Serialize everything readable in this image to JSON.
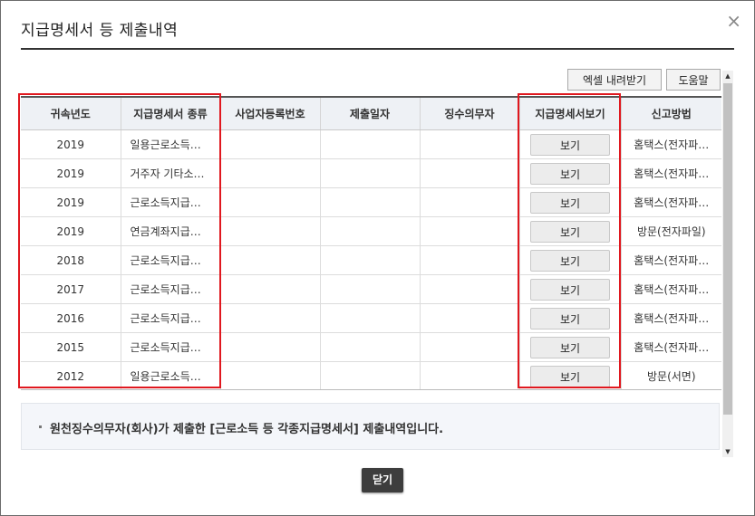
{
  "dialog": {
    "title": "지급명세서 등 제출내역",
    "close_icon": "×"
  },
  "toolbar": {
    "excel_label": "엑셀 내려받기",
    "help_label": "도움말"
  },
  "table": {
    "headers": [
      "귀속년도",
      "지급명세서 종류",
      "사업자등록번호",
      "제출일자",
      "징수의무자",
      "지급명세서보기",
      "신고방법"
    ],
    "rows": [
      {
        "year": "2019",
        "type": "일용근로소득…",
        "biz_no": "",
        "date": "",
        "payer": "",
        "view": "보기",
        "method": "홈택스(전자파…"
      },
      {
        "year": "2019",
        "type": "거주자 기타소…",
        "biz_no": "",
        "date": "",
        "payer": "",
        "view": "보기",
        "method": "홈택스(전자파…"
      },
      {
        "year": "2019",
        "type": "근로소득지급…",
        "biz_no": "",
        "date": "",
        "payer": "",
        "view": "보기",
        "method": "홈택스(전자파…"
      },
      {
        "year": "2019",
        "type": "연금계좌지급…",
        "biz_no": "",
        "date": "",
        "payer": "",
        "view": "보기",
        "method": "방문(전자파일)"
      },
      {
        "year": "2018",
        "type": "근로소득지급…",
        "biz_no": "",
        "date": "",
        "payer": "",
        "view": "보기",
        "method": "홈택스(전자파…"
      },
      {
        "year": "2017",
        "type": "근로소득지급…",
        "biz_no": "",
        "date": "",
        "payer": "",
        "view": "보기",
        "method": "홈택스(전자파…"
      },
      {
        "year": "2016",
        "type": "근로소득지급…",
        "biz_no": "",
        "date": "",
        "payer": "",
        "view": "보기",
        "method": "홈택스(전자파…"
      },
      {
        "year": "2015",
        "type": "근로소득지급…",
        "biz_no": "",
        "date": "",
        "payer": "",
        "view": "보기",
        "method": "홈택스(전자파…"
      },
      {
        "year": "2012",
        "type": "일용근로소득…",
        "biz_no": "",
        "date": "",
        "payer": "",
        "view": "보기",
        "method": "방문(서면)"
      }
    ]
  },
  "notice": {
    "text": "원천징수의무자(회사)가 제출한 [근로소득 등 각종지급명세서] 제출내역입니다."
  },
  "footer": {
    "close_label": "닫기"
  },
  "colors": {
    "highlight": "#e0181f",
    "header_bg": "#eef1f5",
    "close_button": "#3d3d3d"
  }
}
